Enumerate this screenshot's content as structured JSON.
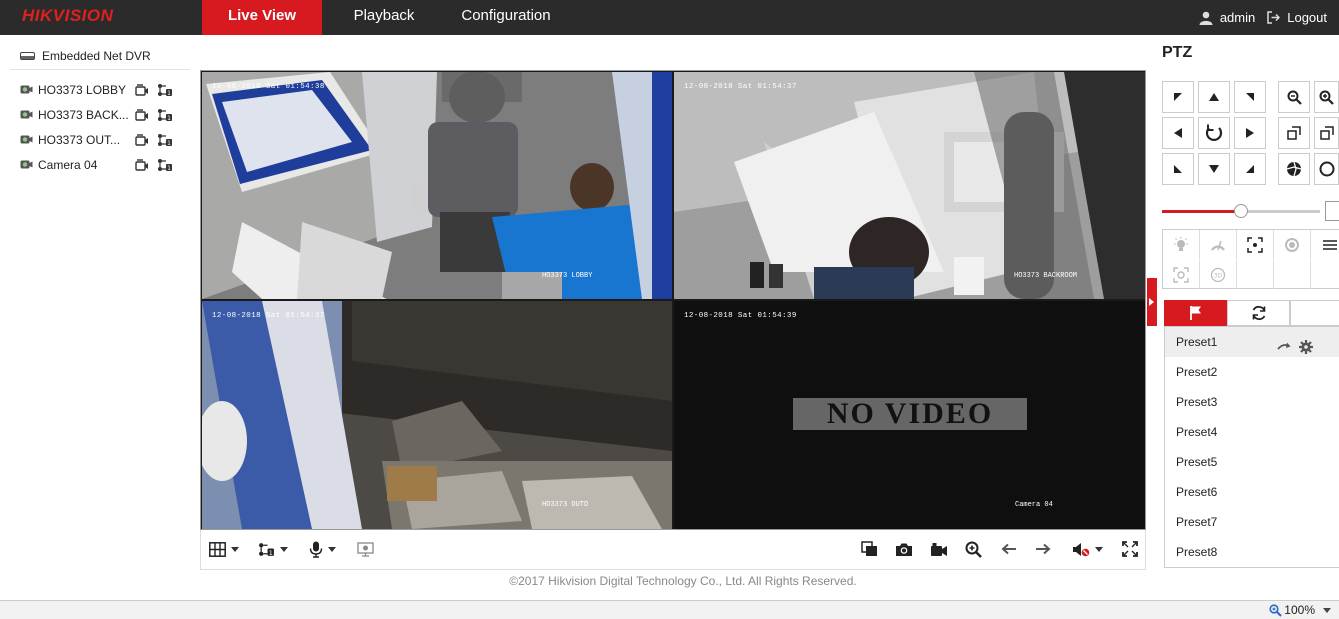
{
  "brand": "HIKVISION",
  "nav": {
    "tabs": [
      "Live View",
      "Playback",
      "Configuration"
    ],
    "active": "Live View"
  },
  "user": {
    "name": "admin",
    "logout": "Logout"
  },
  "tree": {
    "root": "Embedded Net DVR",
    "cameras": [
      "HO3373 LOBBY",
      "HO3373 BACK...",
      "HO3373 OUT...",
      "Camera 04"
    ]
  },
  "tiles": [
    {
      "timestamp": "12-08-2018 Sat 01:54:38",
      "name": "HO3373 LOBBY",
      "selected": true
    },
    {
      "timestamp": "12-08-2018 Sat 01:54:37",
      "name": "HO3373 BACKROOM"
    },
    {
      "timestamp": "12-08-2018 Sat 01:54:37",
      "name": "HO3373 OUTD"
    },
    {
      "timestamp": "12-08-2018 Sat 01:54:39",
      "name": "Camera 04",
      "message": "NO VIDEO"
    }
  ],
  "footer": "©2017 Hikvision Digital Technology Co., Ltd. All Rights Reserved.",
  "ptz": {
    "title": "PTZ",
    "speed_fraction": 0.5,
    "presets": [
      "Preset1",
      "Preset2",
      "Preset3",
      "Preset4",
      "Preset5",
      "Preset6",
      "Preset7",
      "Preset8"
    ]
  },
  "status": {
    "zoom": "100%"
  },
  "colors": {
    "accent": "#d71920",
    "nav_bg": "#2b2b2b",
    "selection": "#e8c24a"
  }
}
